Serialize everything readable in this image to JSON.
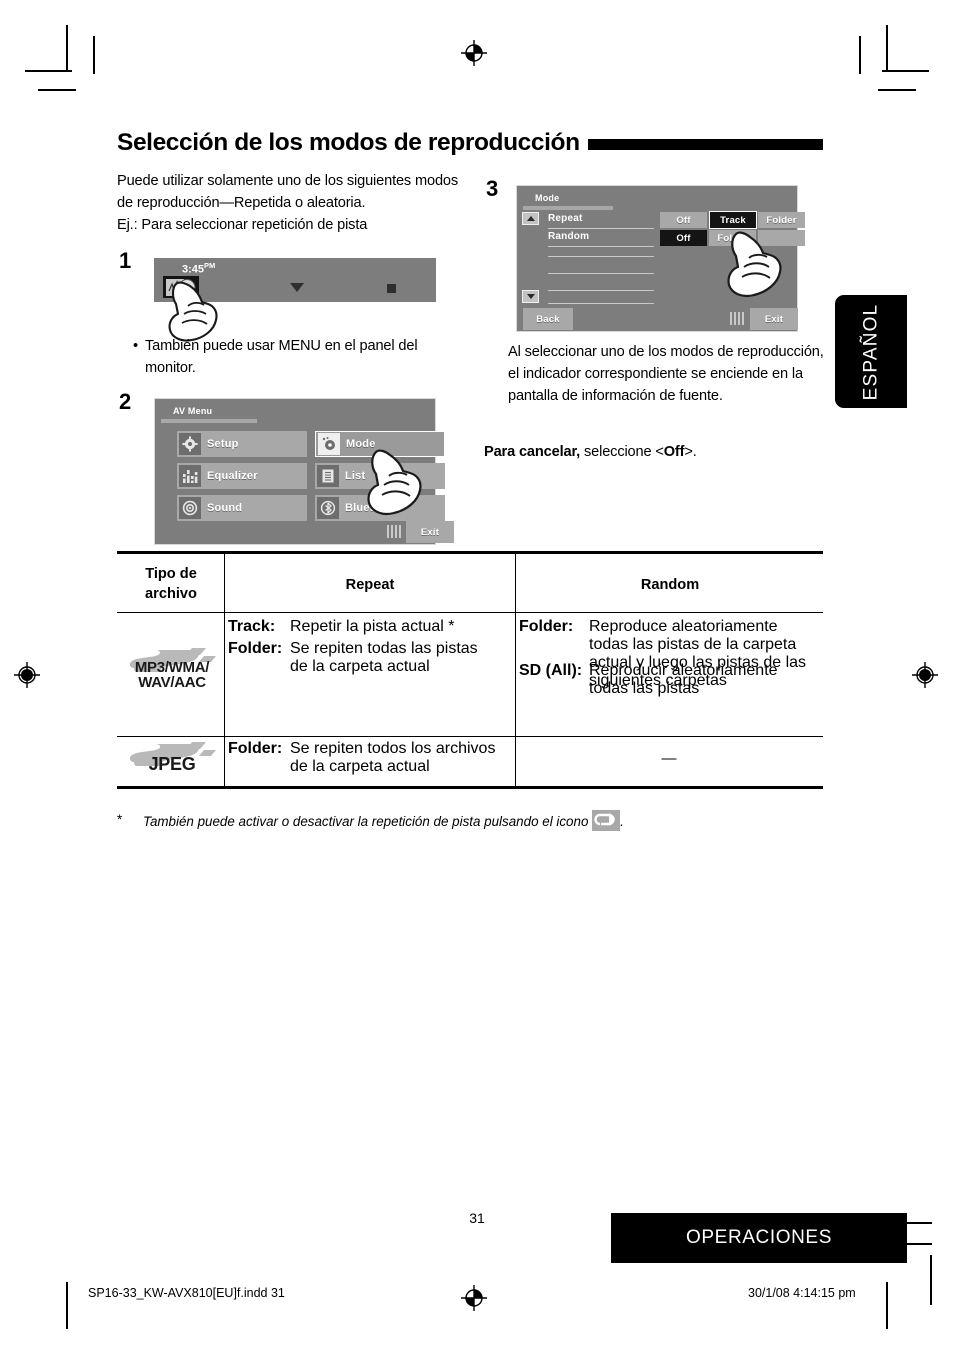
{
  "page": {
    "heading": "Selección de los modos de reproducción",
    "page_number": "31",
    "chapter_tab": "OPERACIONES",
    "language_tab": "ESPAÑOL",
    "file_name": "SP16-33_KW-AVX810[EU]f.indd   31",
    "print_date": "30/1/08   4:14:15 pm"
  },
  "intro": {
    "line1": "Puede utilizar solamente uno de los siguientes modos",
    "line2": "de reproducción—Repetida o aleatoria.",
    "line3": "Ej.: Para seleccionar repetición de pista"
  },
  "steps": {
    "one": {
      "number": "1",
      "note_bullet": "•",
      "note": "También puede usar MENU en el panel del monitor.",
      "screen": {
        "clock": "3:45",
        "meridiem": "PM",
        "source_icon": "disc-source-icon",
        "dropdown_icon": "triangle-down-icon",
        "stop_icon": "stop-square-icon"
      }
    },
    "two": {
      "number": "2",
      "screen": {
        "title": "AV Menu",
        "tiles": [
          {
            "label": "Setup",
            "icon": "gear-icon"
          },
          {
            "label": "Mode",
            "icon": "mode-icon",
            "selected": true
          },
          {
            "label": "Equalizer",
            "icon": "equalizer-icon"
          },
          {
            "label": "List",
            "icon": "list-icon"
          },
          {
            "label": "Sound",
            "icon": "sound-icon"
          },
          {
            "label": "Bluetooth",
            "icon": "bluetooth-icon"
          }
        ],
        "exit": "Exit"
      }
    },
    "three": {
      "number": "3",
      "screen": {
        "title": "Mode",
        "rows": [
          {
            "label": "Repeat",
            "options": [
              {
                "label": "Off",
                "state": "unselected"
              },
              {
                "label": "Track",
                "state": "selected"
              },
              {
                "label": "Folder",
                "state": "unselected"
              }
            ]
          },
          {
            "label": "Random",
            "options": [
              {
                "label": "Off",
                "state": "selected"
              },
              {
                "label": "Folder",
                "state": "unselected"
              },
              {
                "label": "",
                "state": "unselected"
              }
            ]
          }
        ],
        "blank_rows": 4,
        "back": "Back",
        "exit": "Exit",
        "scroll_up_icon": "scroll-up-icon",
        "scroll_down_icon": "scroll-down-icon"
      },
      "body": {
        "line1": "Al seleccionar uno de los modos de reproducción,",
        "line2": "el indicador correspondiente se enciende en la",
        "line3": "pantalla de información de fuente."
      },
      "cancel": {
        "bold": "Para cancelar,",
        "rest": " seleccione <",
        "value": "Off",
        "tail": ">."
      }
    }
  },
  "table": {
    "headers": {
      "col1_line1": "Tipo de",
      "col1_line2": "archivo",
      "col2": "Repeat",
      "col3": "Random"
    },
    "rows": [
      {
        "media_logo": "sd-card-icon",
        "media_label_line1": "MP3/WMA/",
        "media_label_line2": "WAV/AAC",
        "repeat": [
          {
            "key": "Track",
            "sep": ":",
            "text": "Repetir la pista actual *"
          },
          {
            "key": "Folder",
            "sep": ":",
            "text": "Se repiten todas las pistas de la carpeta actual"
          }
        ],
        "random": [
          {
            "key": "Folder",
            "sep": ":",
            "text": "Reproduce aleatoriamente todas las pistas de la carpeta actual y luego las pistas de las siguientes carpetas"
          },
          {
            "key": "SD (All)",
            "sep": ":",
            "text": "Reproducir aleatoriamente todas las pistas"
          }
        ]
      },
      {
        "media_logo": "sd-card-icon",
        "media_label_line1": "JPEG",
        "media_label_line2": "",
        "repeat": [
          {
            "key": "Folder",
            "sep": ":",
            "text": "Se repiten todos los archivos de la carpeta actual"
          }
        ],
        "random_empty": "—"
      }
    ]
  },
  "footnote": {
    "star": "*",
    "text_before": "También puede activar o desactivar la repetición de pista pulsando el icono",
    "icon": "repeat-track-icon",
    "text_after": "."
  }
}
